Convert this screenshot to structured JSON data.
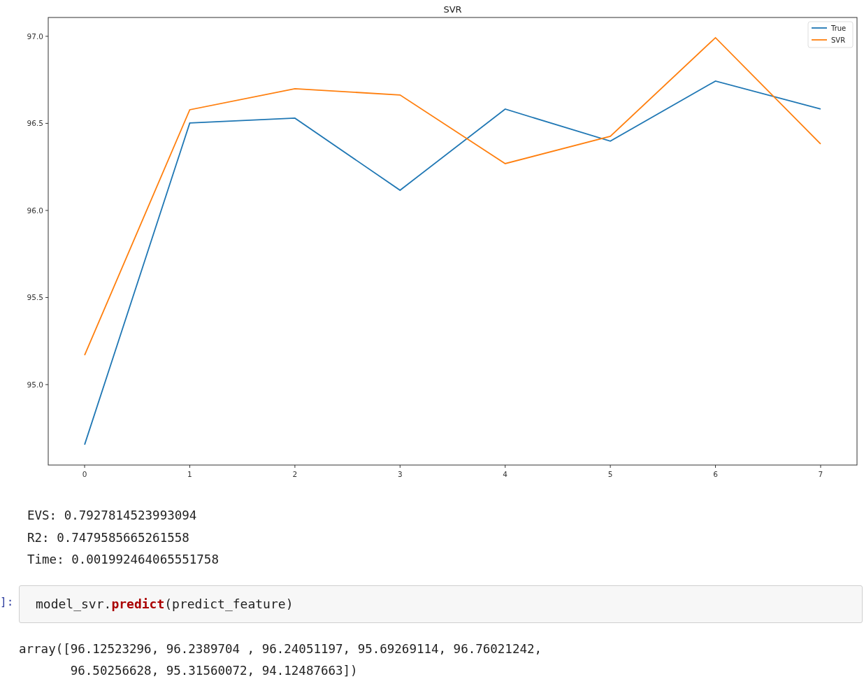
{
  "chart": {
    "chart_data": {
      "type": "line",
      "title": "SVR",
      "x": [
        0,
        1,
        2,
        3,
        4,
        5,
        6,
        7
      ],
      "series": [
        {
          "name": "True",
          "color": "#1f77b4",
          "values": [
            94.655,
            96.502,
            96.53,
            96.116,
            96.582,
            96.398,
            96.743,
            96.582
          ]
        },
        {
          "name": "SVR",
          "color": "#ff7f0e",
          "values": [
            95.169,
            96.578,
            96.699,
            96.663,
            96.269,
            96.426,
            96.992,
            96.382
          ]
        }
      ],
      "legend": true,
      "xlim": [
        -0.346,
        7.346
      ],
      "ylim": [
        94.538,
        97.108
      ],
      "xticks": [
        0,
        1,
        2,
        3,
        4,
        5,
        6,
        7
      ],
      "yticks": [
        {
          "value": 95,
          "label": "95.0"
        },
        {
          "value": 95.5,
          "label": "95.5"
        },
        {
          "value": 96,
          "label": "96.0"
        },
        {
          "value": 96.5,
          "label": "96.5"
        },
        {
          "value": 97,
          "label": "97.0"
        }
      ]
    }
  },
  "metrics_output": [
    "EVS: 0.7927814523993094",
    "R2: 0.7479585665261558",
    "Time: 0.001992464065551758"
  ],
  "input_cell": {
    "prompt": "]:",
    "code": "model_svr.**predict**(predict_feature)"
  },
  "result_output": [
    "array([96.12523296, 96.2389704 , 96.24051197, 95.69269114, 96.76021242,",
    "       96.50256628, 95.31560072, 94.12487663])"
  ]
}
